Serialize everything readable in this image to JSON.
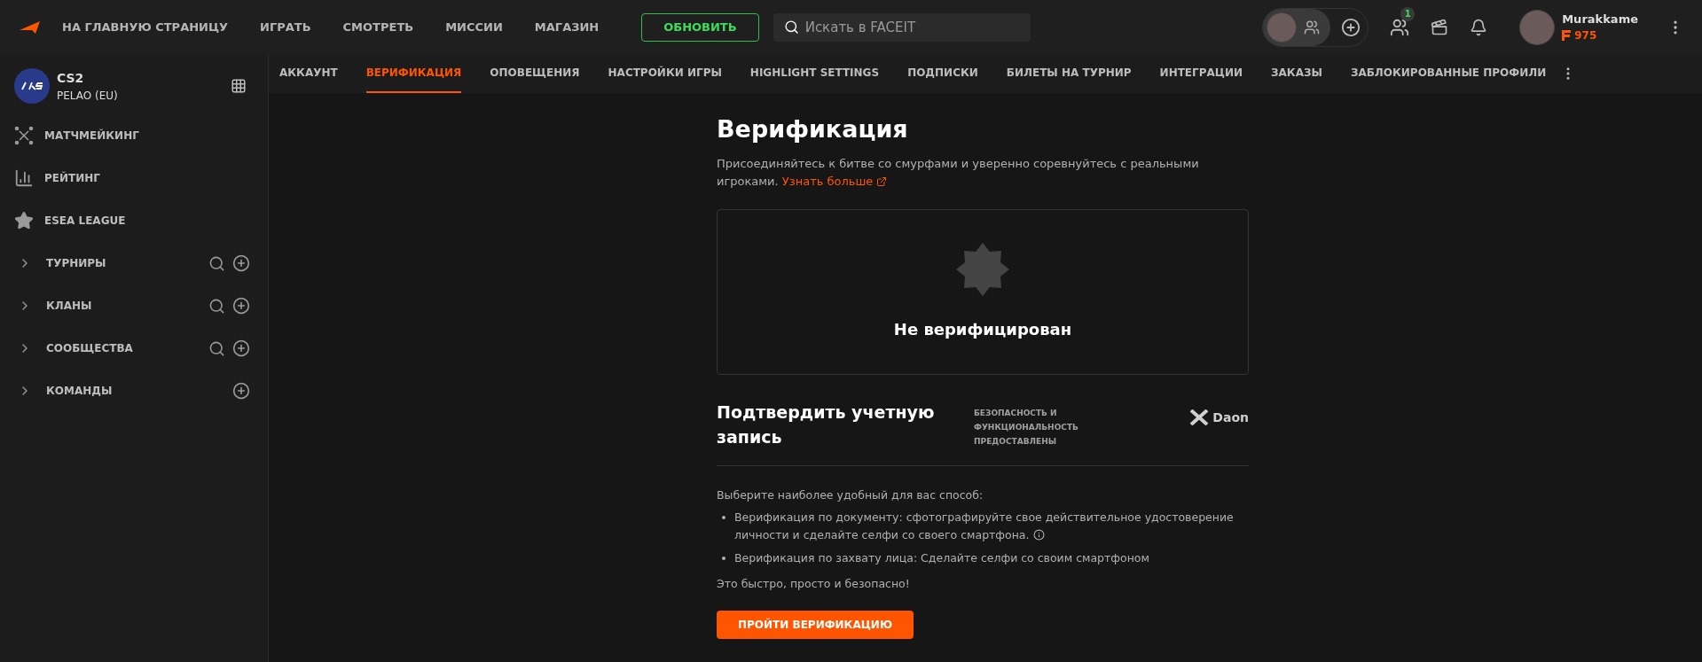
{
  "top_nav": {
    "items": [
      {
        "label": "НА ГЛАВНУЮ СТРАНИЦУ"
      },
      {
        "label": "ИГРАТЬ"
      },
      {
        "label": "СМОТРЕТЬ"
      },
      {
        "label": "МИССИИ"
      },
      {
        "label": "МАГАЗИН"
      }
    ],
    "upgrade_button": "ОБНОВИТЬ",
    "search": {
      "placeholder": "Искать в FACEIT"
    },
    "friends_badge": "1",
    "user": {
      "name": "Murakkame",
      "points": "975"
    }
  },
  "sidebar": {
    "game": {
      "title": "CS2",
      "region": "PELAO (EU)"
    },
    "items": [
      {
        "kind": "link",
        "label": "МАТЧМЕЙКИНГ"
      },
      {
        "kind": "link",
        "label": "РЕЙТИНГ"
      },
      {
        "kind": "link",
        "label": "ESEA LEAGUE"
      },
      {
        "kind": "group",
        "label": "ТУРНИРЫ",
        "expanded": false,
        "searchable": true
      },
      {
        "kind": "group",
        "label": "КЛАНЫ",
        "expanded": false,
        "searchable": true
      },
      {
        "kind": "group",
        "label": "СООБЩЕСТВА",
        "expanded": false,
        "searchable": true
      },
      {
        "kind": "group",
        "label": "КОМАНДЫ",
        "expanded": false,
        "searchable": false
      }
    ]
  },
  "tabs": [
    {
      "label": "АККАУНТ",
      "selected": false
    },
    {
      "label": "ВЕРИФИКАЦИЯ",
      "selected": true
    },
    {
      "label": "ОПОВЕЩЕНИЯ",
      "selected": false
    },
    {
      "label": "НАСТРОЙКИ ИГРЫ",
      "selected": false
    },
    {
      "label": "HIGHLIGHT SETTINGS",
      "selected": false
    },
    {
      "label": "ПОДПИСКИ",
      "selected": false
    },
    {
      "label": "БИЛЕТЫ НА ТУРНИР",
      "selected": false
    },
    {
      "label": "ИНТЕГРАЦИИ",
      "selected": false
    },
    {
      "label": "ЗАКАЗЫ",
      "selected": false
    },
    {
      "label": "ЗАБЛОКИРОВАННЫЕ ПРОФИЛИ",
      "selected": false
    }
  ],
  "verification": {
    "title": "Верификация",
    "description": "Присоединяйтесь к битве со смурфами и уверенно соревнуйтесь с реальными игроками.",
    "learn_more_link": "Узнать больше",
    "status": {
      "verified": false,
      "label": "Не верифицирован"
    },
    "confirm_heading": "Подтвердить учетную запись",
    "provider_note": "БЕЗОПАСНОСТЬ И ФУНКЦИОНАЛЬНОСТЬ ПРЕДОСТАВЛЕНЫ",
    "provider_logo": "Daon",
    "intro": "Выберите наиболее удобный для вас способ:",
    "methods": [
      {
        "text": "Верификация по документу: сфотографируйте свое действительное удостоверение личности и сделайте селфи со своего смартфона.",
        "info": true
      },
      {
        "text": "Верификация по захвату лица: Сделайте селфи со своим смартфоном",
        "info": false
      }
    ],
    "outro": "Это быстро, просто и безопасно!",
    "start_button": "ПРОЙТИ ВЕРИФИКАЦИЮ"
  }
}
